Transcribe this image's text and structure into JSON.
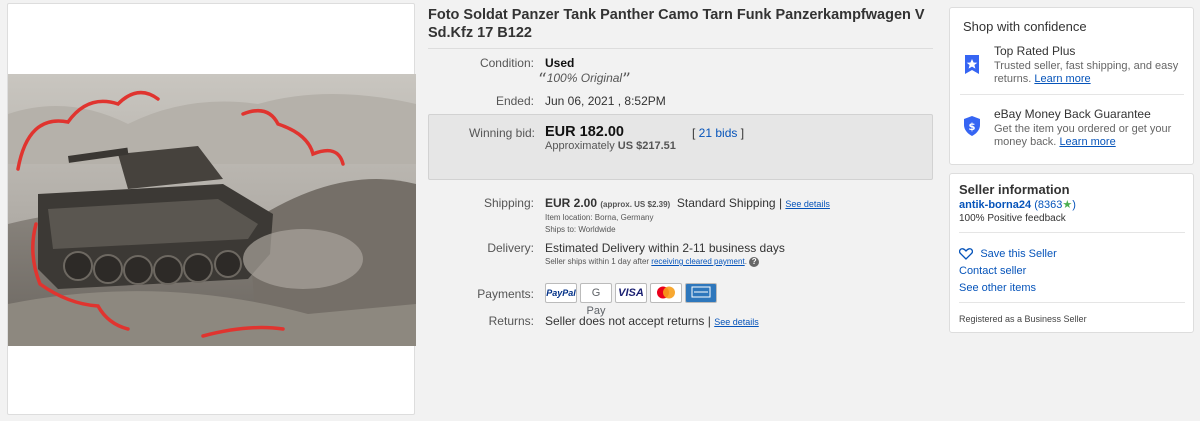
{
  "listing": {
    "title": "Foto Soldat Panzer Tank Panther Camo Tarn Funk Panzerkampfwagen V Sd.Kfz 17 B122"
  },
  "details": {
    "condition_label": "Condition:",
    "condition_value": "Used",
    "condition_note": "100% Original",
    "ended_label": "Ended:",
    "ended_value": "Jun 06, 2021 , 8:52PM",
    "winning_bid_label": "Winning bid:",
    "winning_bid_value": "EUR 182.00",
    "approx_label": "Approximately",
    "approx_value": "US $217.51",
    "bids_link": "21 bids",
    "shipping_label": "Shipping:",
    "shipping_value": "EUR 2.00",
    "shipping_approx": "(approx. US $2.39)",
    "shipping_method": "Standard Shipping",
    "see_details": "See details",
    "item_location": "Item location:  Borna, Germany",
    "ships_to": "Ships to:  Worldwide",
    "delivery_label": "Delivery:",
    "delivery_value": "Estimated Delivery within 2-11 business days",
    "delivery_note_prefix": "Seller ships within 1 day after",
    "delivery_note_link": "receiving cleared payment",
    "payments_label": "Payments:",
    "returns_label": "Returns:",
    "returns_value": "Seller does not accept returns",
    "returns_see_details": "See details"
  },
  "payment_methods": {
    "paypal": "PayPal",
    "gpay": "G Pay",
    "visa": "VISA"
  },
  "confidence": {
    "title": "Shop with confidence",
    "top_rated_title": "Top Rated Plus",
    "top_rated_text": "Trusted seller, fast shipping, and easy returns.",
    "top_rated_link": "Learn more",
    "guarantee_title": "eBay Money Back Guarantee",
    "guarantee_text": "Get the item you ordered or get your money back.",
    "guarantee_link": "Learn more"
  },
  "seller": {
    "title": "Seller information",
    "name": "antik-borna24",
    "score": "(8363",
    "feedback": "100% Positive feedback",
    "save_seller": "Save this Seller",
    "contact": "Contact seller",
    "other_items": "See other items",
    "business": "Registered as a Business Seller"
  },
  "colors": {
    "link": "#0654ba",
    "star": "#4caf50",
    "shield": "#3665f3",
    "ink": "#e0342f"
  }
}
